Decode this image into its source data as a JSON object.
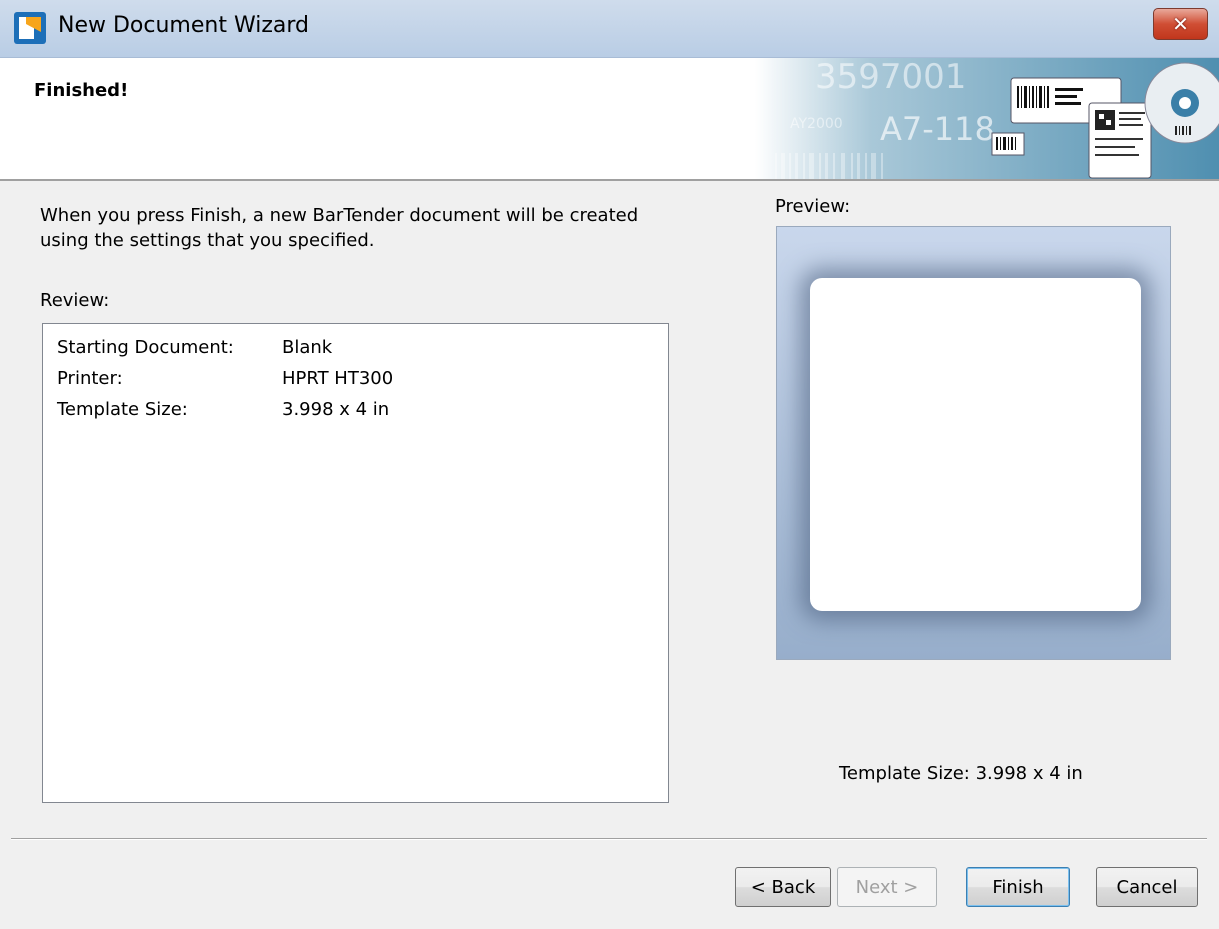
{
  "window": {
    "title": "New Document Wizard",
    "close_label": "✕"
  },
  "header": {
    "title": "Finished!",
    "banner_text_1": "3597001",
    "banner_text_2": "A7-118",
    "banner_text_3": "AY2000"
  },
  "intro": {
    "text": "When you press Finish, a new BarTender document will be created using the settings that you specified."
  },
  "review": {
    "label": "Review:",
    "rows": [
      {
        "key": "Starting Document:",
        "value": "Blank"
      },
      {
        "key": "Printer:",
        "value": "HPRT HT300"
      },
      {
        "key": "Template Size:",
        "value": "3.998 x 4 in"
      }
    ]
  },
  "preview": {
    "label": "Preview:",
    "template_size": "Template Size:  3.998 x 4 in"
  },
  "buttons": {
    "back": "< Back",
    "next": "Next >",
    "finish": "Finish",
    "cancel": "Cancel"
  },
  "colors": {
    "accent": "#3c7fb1",
    "close": "#c1361c",
    "preview_bg": "#a8bcd6"
  },
  "icons": {
    "app": "bartender-app-icon",
    "close": "close-icon"
  }
}
